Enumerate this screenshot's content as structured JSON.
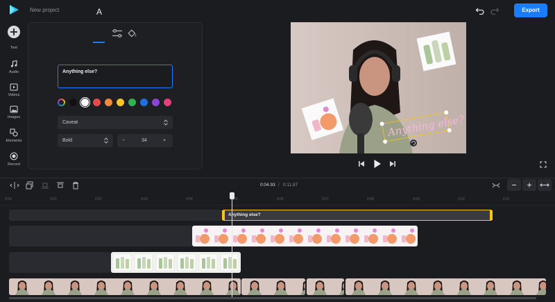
{
  "app": {
    "project_title": "New project",
    "export_label": "Export"
  },
  "rail": [
    {
      "label": "Text",
      "icon": "plus-circle-icon"
    },
    {
      "label": "Audio",
      "icon": "music-note-icon"
    },
    {
      "label": "Videos",
      "icon": "video-icon"
    },
    {
      "label": "Images",
      "icon": "image-icon"
    },
    {
      "label": "Elements",
      "icon": "shapes-icon"
    },
    {
      "label": "Record",
      "icon": "record-icon"
    }
  ],
  "panel": {
    "tabs": [
      "text-style-icon",
      "sliders-icon",
      "paint-bucket-icon"
    ],
    "text_value": "Anything else?",
    "colors": [
      "#111111",
      "#ffffff",
      "#e84a4a",
      "#f08a3c",
      "#f5c52a",
      "#2fb34f",
      "#1f6fe0",
      "#8a44d8",
      "#e0407c"
    ],
    "font": "Caveat",
    "weight": "Bold",
    "size": "34"
  },
  "preview": {
    "overlay_text": "Anything else?"
  },
  "timeline": {
    "current_time": "0:04.93",
    "separator": "/",
    "total_time": "0:11.87",
    "ticks": [
      "0:00",
      "0:01",
      "0:02",
      "0:03",
      "0:04",
      "0:05",
      "0:06",
      "0:07",
      "0:08",
      "0:09",
      "0:10",
      "0:11"
    ],
    "text_clip_label": "Anything else?"
  },
  "colors": {
    "accent": "#1a7cff",
    "selection": "#f5c518",
    "background": "#1b1c1f"
  }
}
